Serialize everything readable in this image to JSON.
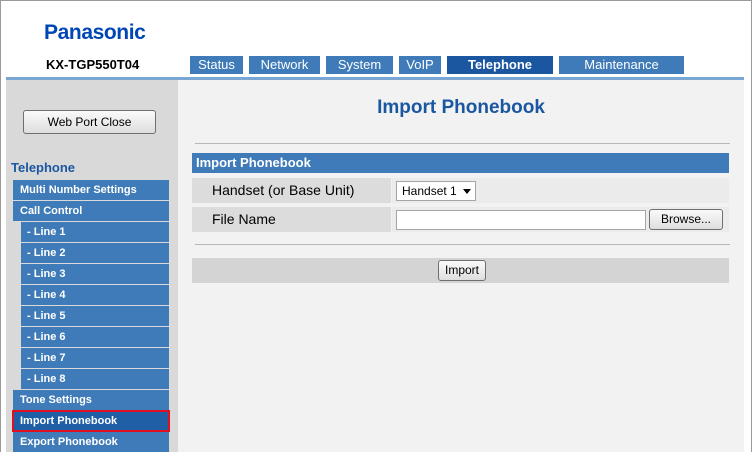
{
  "header": {
    "brand": "Panasonic",
    "model": "KX-TGP550T04"
  },
  "tabs": [
    {
      "label": "Status"
    },
    {
      "label": "Network"
    },
    {
      "label": "System"
    },
    {
      "label": "VoIP"
    },
    {
      "label": "Telephone",
      "active": true
    },
    {
      "label": "Maintenance"
    }
  ],
  "sidebar": {
    "web_port_button": "Web Port Close",
    "section_title": "Telephone",
    "items": [
      {
        "label": "Multi Number Settings"
      },
      {
        "label": "Call Control"
      },
      {
        "label": "- Line 1"
      },
      {
        "label": "- Line 2"
      },
      {
        "label": "- Line 3"
      },
      {
        "label": "- Line 4"
      },
      {
        "label": "- Line 5"
      },
      {
        "label": "- Line 6"
      },
      {
        "label": "- Line 7"
      },
      {
        "label": "- Line 8"
      },
      {
        "label": "Tone Settings"
      },
      {
        "label": "Import Phonebook",
        "selected": true
      },
      {
        "label": "Export Phonebook"
      }
    ]
  },
  "main": {
    "page_title": "Import Phonebook",
    "section_title": "Import Phonebook",
    "handset_label": "Handset (or Base Unit)",
    "handset_value": "Handset 1",
    "file_name_label": "File Name",
    "file_name_value": "",
    "browse_label": "Browse...",
    "import_label": "Import"
  },
  "colors": {
    "brand": "#0046b4",
    "tab": "#3f7bb8",
    "tab_active": "#1a57a0",
    "menu": "#3f7bb8",
    "highlight": "#e01020"
  }
}
